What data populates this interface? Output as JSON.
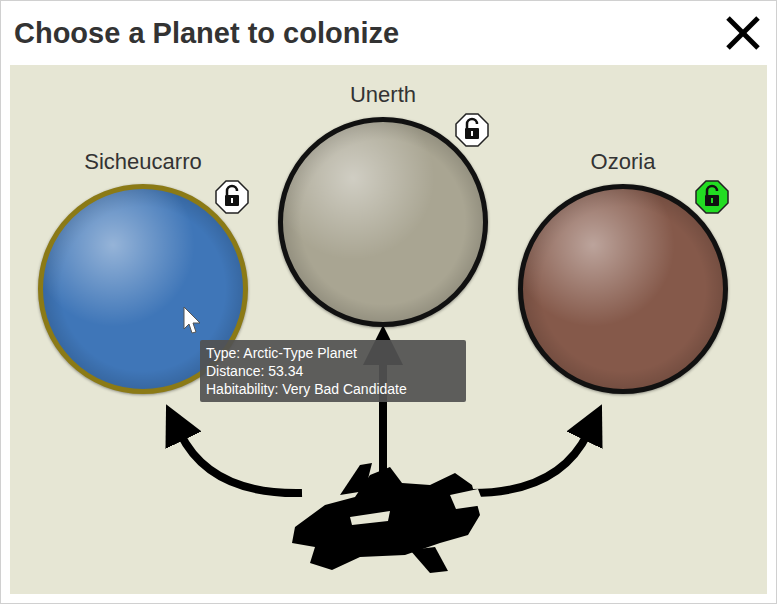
{
  "window": {
    "title": "Choose a Planet to colonize"
  },
  "planets": [
    {
      "name": "Sicheucarro",
      "selected": true,
      "available": false,
      "color": "#3f76b8"
    },
    {
      "name": "Unerth",
      "selected": false,
      "available": false,
      "color": "#a9a592"
    },
    {
      "name": "Ozoria",
      "selected": false,
      "available": true,
      "color": "#85594a"
    }
  ],
  "tooltip": {
    "lines": [
      "Type: Arctic-Type Planet",
      "Distance: 53.34",
      "Habitability: Very Bad Candidate"
    ]
  }
}
